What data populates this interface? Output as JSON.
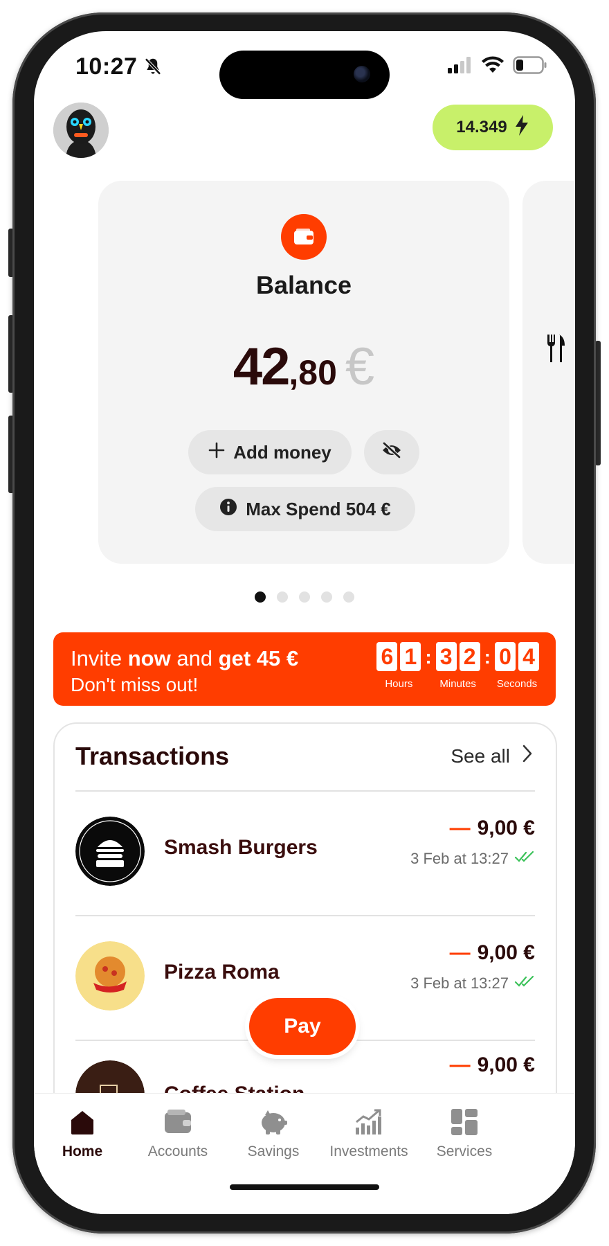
{
  "status_bar": {
    "time": "10:27"
  },
  "header": {
    "points": "14.349"
  },
  "balance_card": {
    "title": "Balance",
    "amount_int": "42",
    "amount_dec": ",80",
    "currency": "€",
    "add_money_label": "Add money",
    "max_spend_label": "Max Spend 504 €"
  },
  "carousel": {
    "pages": 5,
    "active": 1
  },
  "invite_banner": {
    "line1_pre": "Invite ",
    "line1_bold1": "now",
    "line1_mid": " and ",
    "line1_bold2": "get 45 €",
    "line2": "Don't miss out!",
    "hours": [
      "6",
      "1"
    ],
    "minutes": [
      "3",
      "2"
    ],
    "seconds": [
      "0",
      "4"
    ],
    "hours_label": "Hours",
    "minutes_label": "Minutes",
    "seconds_label": "Seconds"
  },
  "transactions": {
    "title": "Transactions",
    "see_all": "See all",
    "items": [
      {
        "name": "Smash Burgers",
        "amount": "9,00 €",
        "date": "3 Feb at 13:27"
      },
      {
        "name": "Pizza Roma",
        "amount": "9,00 €",
        "date": "3 Feb at 13:27"
      },
      {
        "name": "Coffee Station",
        "amount": "9,00 €",
        "date": ""
      }
    ]
  },
  "pay_button": "Pay",
  "tabs": [
    {
      "label": "Home",
      "icon": "home-icon"
    },
    {
      "label": "Accounts",
      "icon": "wallet-icon"
    },
    {
      "label": "Savings",
      "icon": "piggy-bank-icon"
    },
    {
      "label": "Investments",
      "icon": "chart-icon"
    },
    {
      "label": "Services",
      "icon": "grid-icon"
    }
  ],
  "colors": {
    "accent": "#ff3d00",
    "points_badge": "#c8f06a",
    "text_dark": "#2a0a0a"
  }
}
